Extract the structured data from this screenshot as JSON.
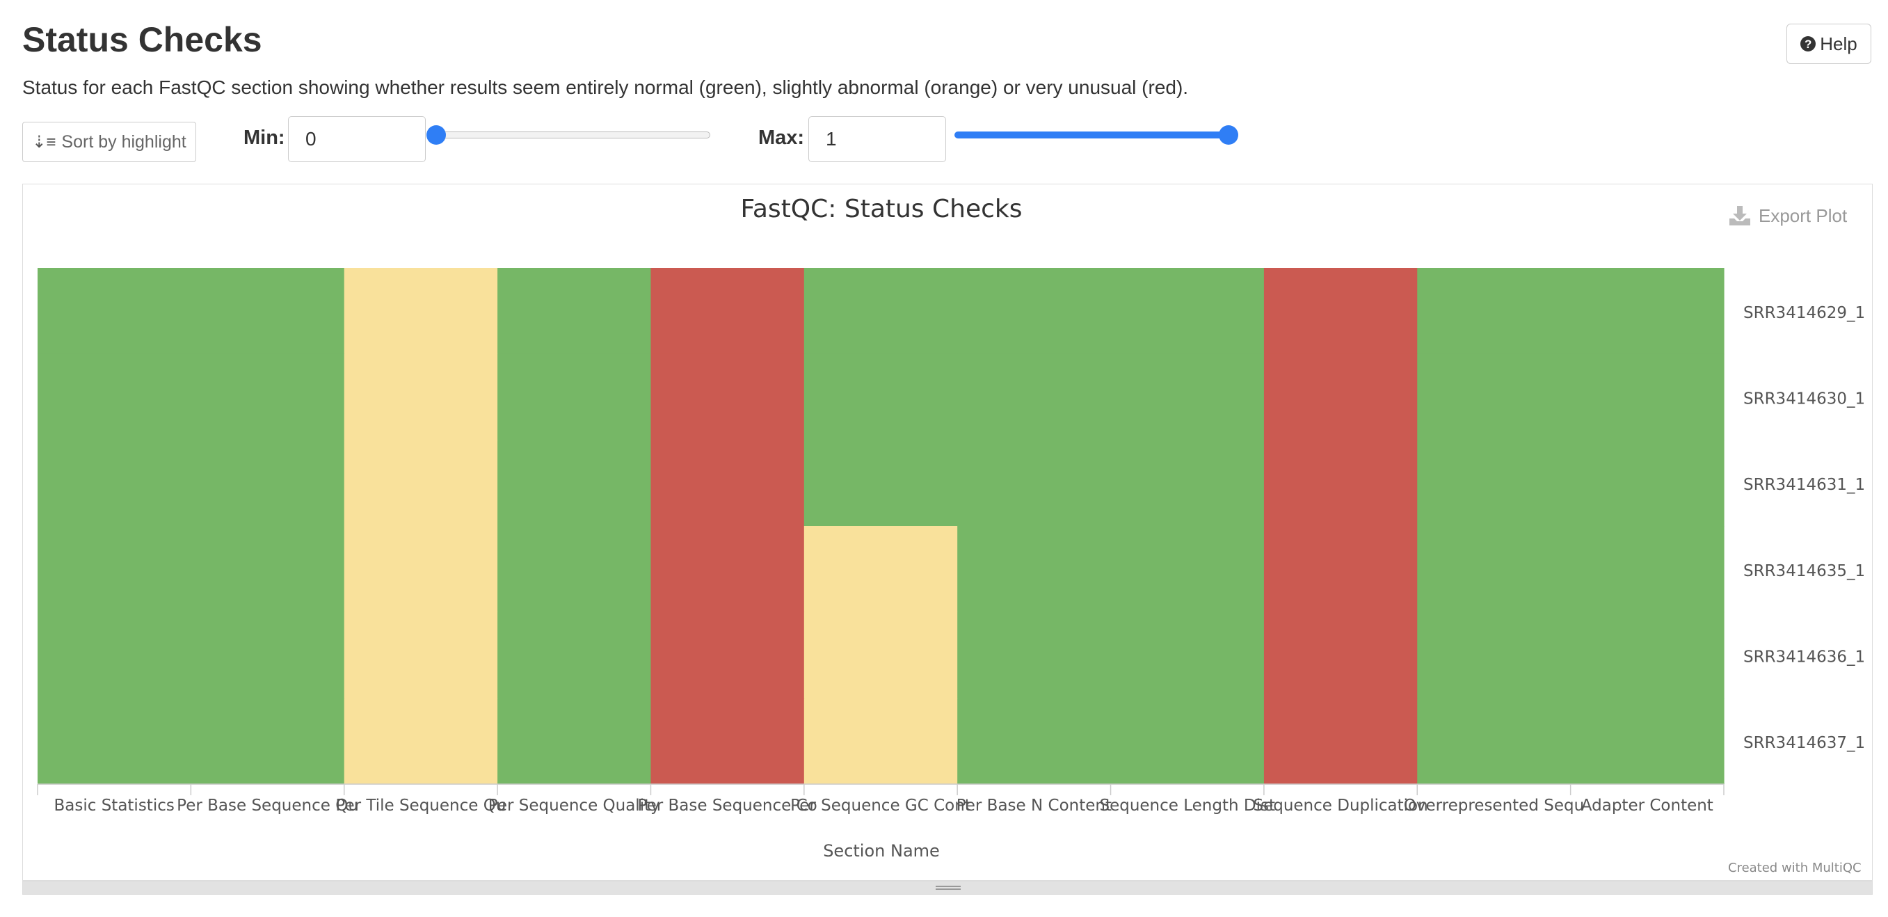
{
  "header": {
    "title": "Status Checks",
    "help_label": "Help",
    "description": "Status for each FastQC section showing whether results seem entirely normal (green), slightly abnormal (orange) or very unusual (red)."
  },
  "controls": {
    "sort_label": "Sort by highlight",
    "min_label": "Min:",
    "min_value": "0",
    "min_slider_value": 0,
    "max_label": "Max:",
    "max_value": "1",
    "max_slider_value": 1
  },
  "plot": {
    "export_label": "Export Plot",
    "credit": "Created with MultiQC"
  },
  "colors": {
    "pass": "#76b766",
    "warn": "#f9e19b",
    "fail": "#cb5a51",
    "accent": "#2f7ef5"
  },
  "chart_data": {
    "type": "heatmap",
    "title": "FastQC: Status Checks",
    "xlabel": "Section Name",
    "ylabel": "",
    "x_categories": [
      "Basic Statistics",
      "Per Base Sequence Qu",
      "Per Tile Sequence Qu",
      "Per Sequence Quality",
      "Per Base Sequence Co",
      "Per Sequence GC Cont",
      "Per Base N Content",
      "Sequence Length Dist",
      "Sequence Duplication",
      "Overrepresented Sequ",
      "Adapter Content"
    ],
    "y_categories": [
      "SRR3414629_1",
      "SRR3414630_1",
      "SRR3414631_1",
      "SRR3414635_1",
      "SRR3414636_1",
      "SRR3414637_1"
    ],
    "status_values": {
      "pass": 1,
      "warn": 0.5,
      "fail": 0.25
    },
    "values": [
      [
        1,
        1,
        0.5,
        1,
        0.25,
        1,
        1,
        1,
        0.25,
        1,
        1
      ],
      [
        1,
        1,
        0.5,
        1,
        0.25,
        1,
        1,
        1,
        0.25,
        1,
        1
      ],
      [
        1,
        1,
        0.5,
        1,
        0.25,
        1,
        1,
        1,
        0.25,
        1,
        1
      ],
      [
        1,
        1,
        0.5,
        1,
        0.25,
        0.5,
        1,
        1,
        0.25,
        1,
        1
      ],
      [
        1,
        1,
        0.5,
        1,
        0.25,
        0.5,
        1,
        1,
        0.25,
        1,
        1
      ],
      [
        1,
        1,
        0.5,
        1,
        0.25,
        0.5,
        1,
        1,
        0.25,
        1,
        1
      ]
    ]
  }
}
